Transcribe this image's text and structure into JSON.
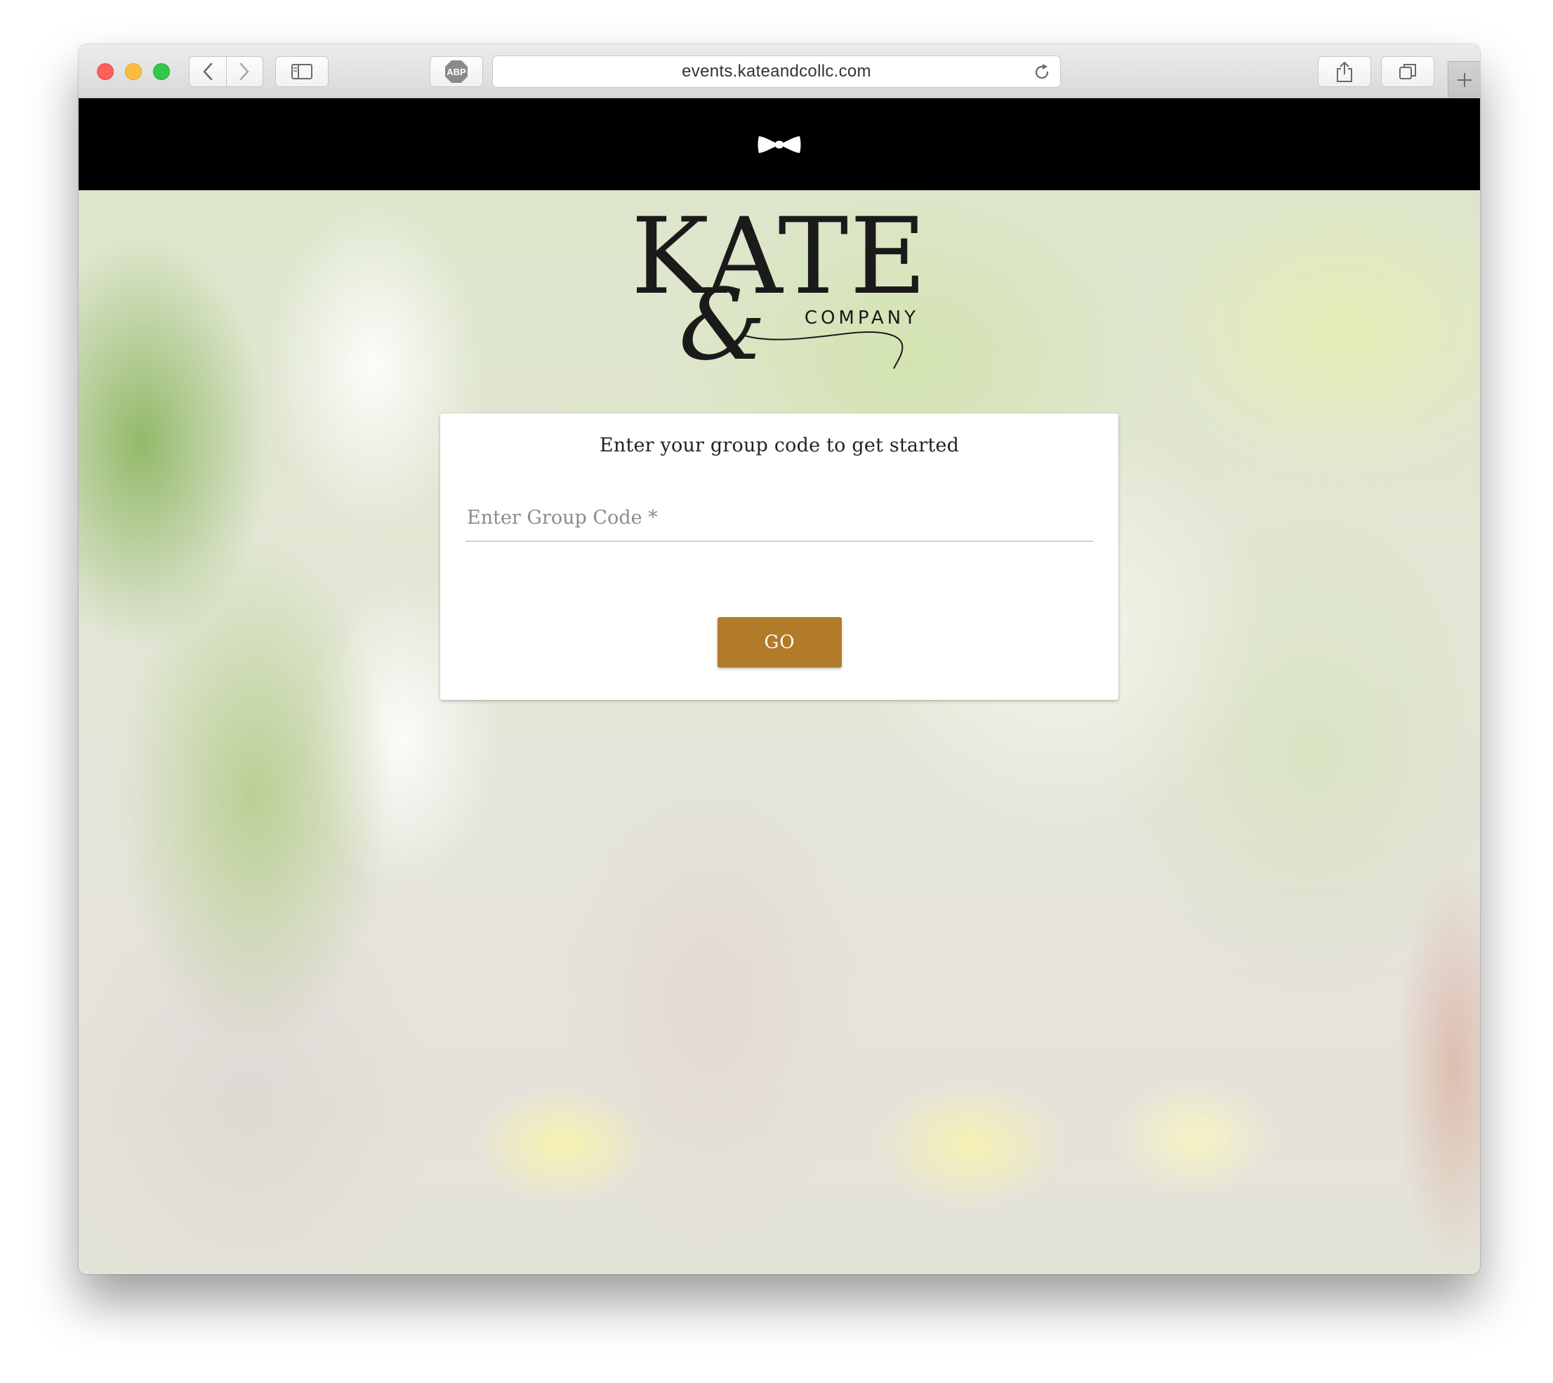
{
  "browser": {
    "url": "events.kateandcollc.com",
    "adblock_label": "ABP",
    "icons": {
      "back": "chevron-left-icon",
      "forward": "chevron-right-icon",
      "sidebar": "sidebar-icon",
      "reload": "reload-icon",
      "share": "share-icon",
      "tabs": "tabs-icon",
      "new_tab": "plus-icon"
    }
  },
  "header": {
    "logo_icon": "bowtie-icon",
    "background": "#000000"
  },
  "brand": {
    "name": "KATE",
    "ampersand": "&",
    "subtitle": "COMPANY"
  },
  "card": {
    "title": "Enter your group code to get started",
    "field": {
      "label": "Enter Group Code *",
      "value": ""
    },
    "button_label": "GO"
  },
  "colors": {
    "accent": "#b27b29",
    "logo": "#1a1a1a"
  }
}
